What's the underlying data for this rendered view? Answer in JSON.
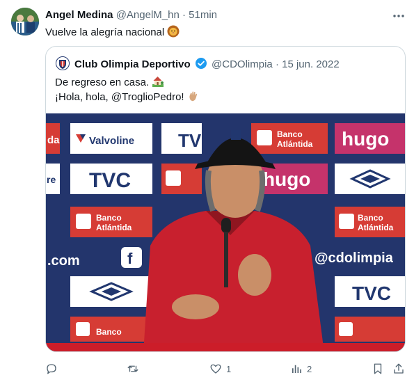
{
  "tweet": {
    "author_name": "Angel Medina",
    "author_handle": "@AngelM_hn",
    "separator": "·",
    "time": "51min",
    "text": "Vuelve la alegría nacional",
    "text_emoji": "lion-face"
  },
  "quote": {
    "author_name": "Club Olimpia Deportivo",
    "verified": true,
    "author_handle": "@CDOlimpia",
    "separator": "·",
    "date": "15 jun. 2022",
    "line1": "De regreso en casa.",
    "line1_emoji": "house-with-garden",
    "line2_prefix": "¡Hola, hola, ",
    "line2_mention": "@TroglioPedro",
    "line2_suffix": "!",
    "line2_emoji": "waving-hand",
    "photo_boards": {
      "valvoline": "Valvoline",
      "tvc": "TVC",
      "banco_line1": "Banco",
      "banco_line2": "Atlántida",
      "hugo": "hugo",
      "cdolimpia": "@cdolimpia",
      "com": ".com",
      "fb": "f",
      "re": "re",
      "da": "da",
      "tv": "TV"
    }
  },
  "actions": {
    "replies": "",
    "retweets": "",
    "likes": "1",
    "views": "2"
  },
  "colors": {
    "text_primary": "#0f1419",
    "text_secondary": "#536471",
    "verified_blue": "#1d9bf0",
    "board_red": "#d63c35",
    "board_navy": "#21376f"
  }
}
